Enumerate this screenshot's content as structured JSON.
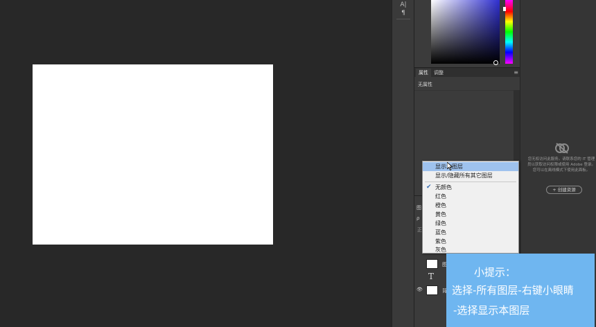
{
  "tool_strip": {
    "top_glyph": "A|",
    "second_glyph": "¶"
  },
  "color_picker": {
    "hue_slider": "hue-slider"
  },
  "properties": {
    "tabs": [
      {
        "label": "属性",
        "active": true
      },
      {
        "label": "调整",
        "active": false
      }
    ],
    "menu_glyph": "≡",
    "empty_label": "无属性"
  },
  "libraries": {
    "message": "您无权访问此服务。请联系您的 IT 管理员以获取访问权限或使用 Adobe 登录。您可以在离线模式下使用此面板。",
    "create_button": "+ 创建资源"
  },
  "layers": {
    "tab_label": "图",
    "filter_label": "ρ",
    "mode_label": "正",
    "rows": [
      {
        "vis": "",
        "name": "图",
        "kind": "image"
      },
      {
        "vis": "",
        "name": "",
        "kind": "text",
        "glyph": "T"
      },
      {
        "vis": "👁",
        "name": "背",
        "kind": "background"
      }
    ]
  },
  "context_menu": {
    "items": [
      {
        "label": "显示本图层",
        "highlighted": true,
        "checked": false
      },
      {
        "label": "显示/隐藏所有其它图层",
        "highlighted": false,
        "checked": false
      },
      {
        "label": "无颜色",
        "highlighted": false,
        "checked": true
      },
      {
        "label": "红色",
        "highlighted": false,
        "checked": false
      },
      {
        "label": "橙色",
        "highlighted": false,
        "checked": false
      },
      {
        "label": "黄色",
        "highlighted": false,
        "checked": false
      },
      {
        "label": "绿色",
        "highlighted": false,
        "checked": false
      },
      {
        "label": "蓝色",
        "highlighted": false,
        "checked": false
      },
      {
        "label": "紫色",
        "highlighted": false,
        "checked": false
      },
      {
        "label": "灰色",
        "highlighted": false,
        "checked": false
      }
    ],
    "check_glyph": "✔"
  },
  "tip": {
    "title": "小提示：",
    "line1": "选择-所有图层-右键小眼睛",
    "line2": "-选择显示本图层"
  },
  "colors": {
    "canvas_bg": "#282828",
    "panel_bg": "#3b3b3b",
    "tip_bg": "#6fb6f0",
    "menu_highlight": "#9ec2ee"
  }
}
